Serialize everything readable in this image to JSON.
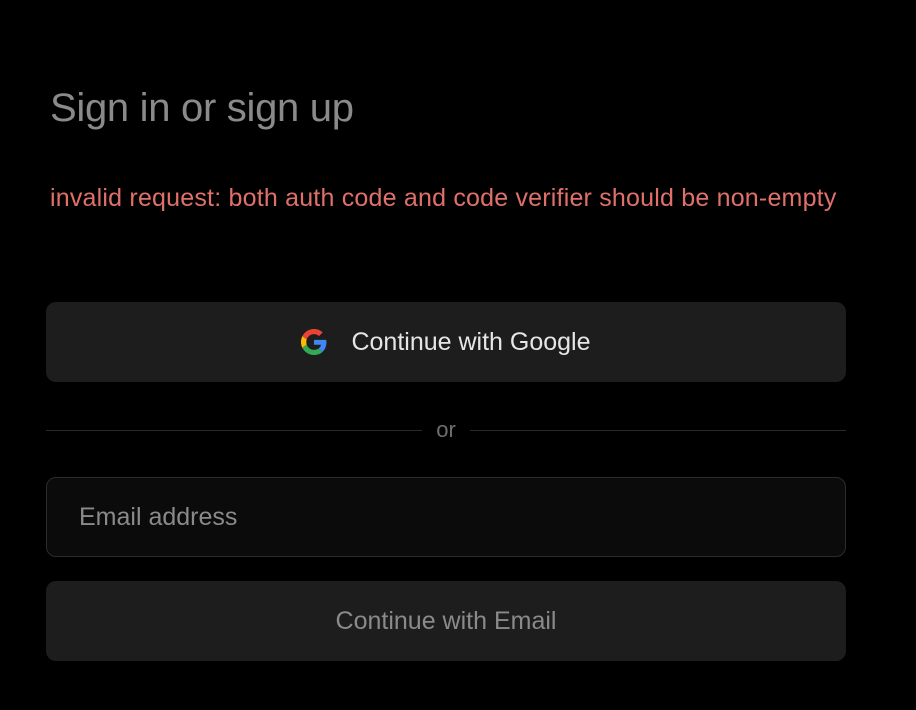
{
  "heading": "Sign in or sign up",
  "error_message": "invalid request: both auth code and code verifier should be non-empty",
  "google_button": {
    "label": "Continue with Google",
    "icon": "google-icon"
  },
  "divider_text": "or",
  "email_field": {
    "placeholder": "Email address",
    "value": ""
  },
  "email_button": {
    "label": "Continue with Email"
  },
  "colors": {
    "background": "#000000",
    "error": "#e0706a",
    "button_bg": "#1d1d1d",
    "input_bg": "#0b0b0b",
    "google_blue": "#4285F4",
    "google_red": "#EA4335",
    "google_yellow": "#FBBC05",
    "google_green": "#34A853"
  }
}
